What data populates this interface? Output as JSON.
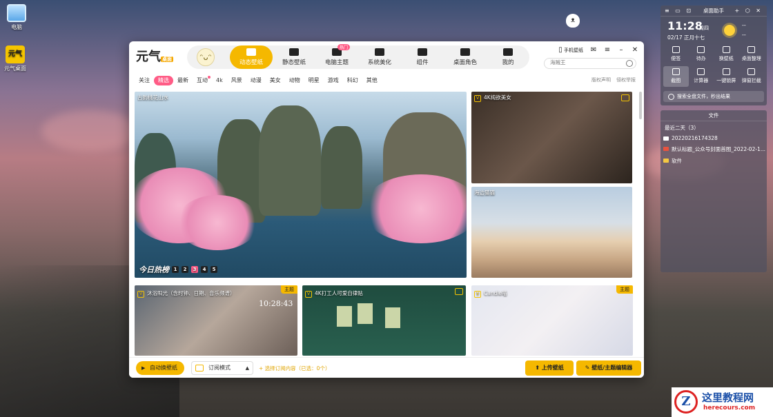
{
  "desktop": {
    "icons": [
      {
        "label": "电脑"
      },
      {
        "label": "元气桌面",
        "logo_text": "元气"
      }
    ]
  },
  "app": {
    "logo_text": "元气",
    "logo_sub": "桌面",
    "nav": [
      {
        "label": "动态壁纸",
        "active": true
      },
      {
        "label": "静态壁纸"
      },
      {
        "label": "电脑主题",
        "badge": "热门"
      },
      {
        "label": "系统美化"
      },
      {
        "label": "组件"
      },
      {
        "label": "桌面角色"
      },
      {
        "label": "我的"
      }
    ],
    "top_actions": {
      "phone_wallpaper": "手机壁纸"
    },
    "search": {
      "placeholder": "海贼王"
    },
    "categories": [
      "关注",
      "精选",
      "最新",
      "互动",
      "4k",
      "风景",
      "动漫",
      "美女",
      "动物",
      "明星",
      "游戏",
      "科幻",
      "其他"
    ],
    "active_category": "精选",
    "right_links": [
      "版权声明",
      "侵权举报"
    ],
    "tiles": {
      "main": {
        "label": "古韵桃花山水",
        "hot_label": "今日热榜",
        "pages": [
          "1",
          "2",
          "3",
          "4",
          "5"
        ],
        "active_page": "3"
      },
      "girl": {
        "label": "4K纯欲美女"
      },
      "sea": {
        "label": "海边猫猫"
      },
      "b1": {
        "label": "沐浴阳光（含时钟、日期、音乐频谱）",
        "tag": "主题",
        "clock": "10:28:43"
      },
      "b2": {
        "label": "4K打工人可爱自律贴"
      },
      "b3": {
        "label": "Candle喵",
        "tag": "主题"
      }
    },
    "bottom": {
      "auto_change": "自动换壁纸",
      "subscribe_mode": "订阅模式",
      "subscribe_hint": "+ 选择订阅内容（已选：0个）",
      "upload": "上传壁纸",
      "editor": "壁纸/主题编辑器"
    }
  },
  "assistant": {
    "title": "桌面助手",
    "time": "11:28",
    "weekday": "周四",
    "date": "02/17",
    "lunar": "正月十七",
    "temp_high": "--",
    "temp_low": "--",
    "tools": [
      "便签",
      "待办",
      "换壁纸",
      "桌面整理",
      "截图",
      "计算器",
      "一键锁屏",
      "弹窗拦截"
    ],
    "search_placeholder": "搜索全盘文件，秒出结果"
  },
  "files": {
    "title": "文件",
    "group": "最近二天（3）",
    "items": [
      {
        "name": "20220216174328",
        "type": "image"
      },
      {
        "name": "默认标题_公众号封面首图_2022-02-1...",
        "type": "doc"
      },
      {
        "name": "软件",
        "type": "folder"
      }
    ]
  },
  "watermark": {
    "title": "这里教程网",
    "url": "herecours.com"
  }
}
